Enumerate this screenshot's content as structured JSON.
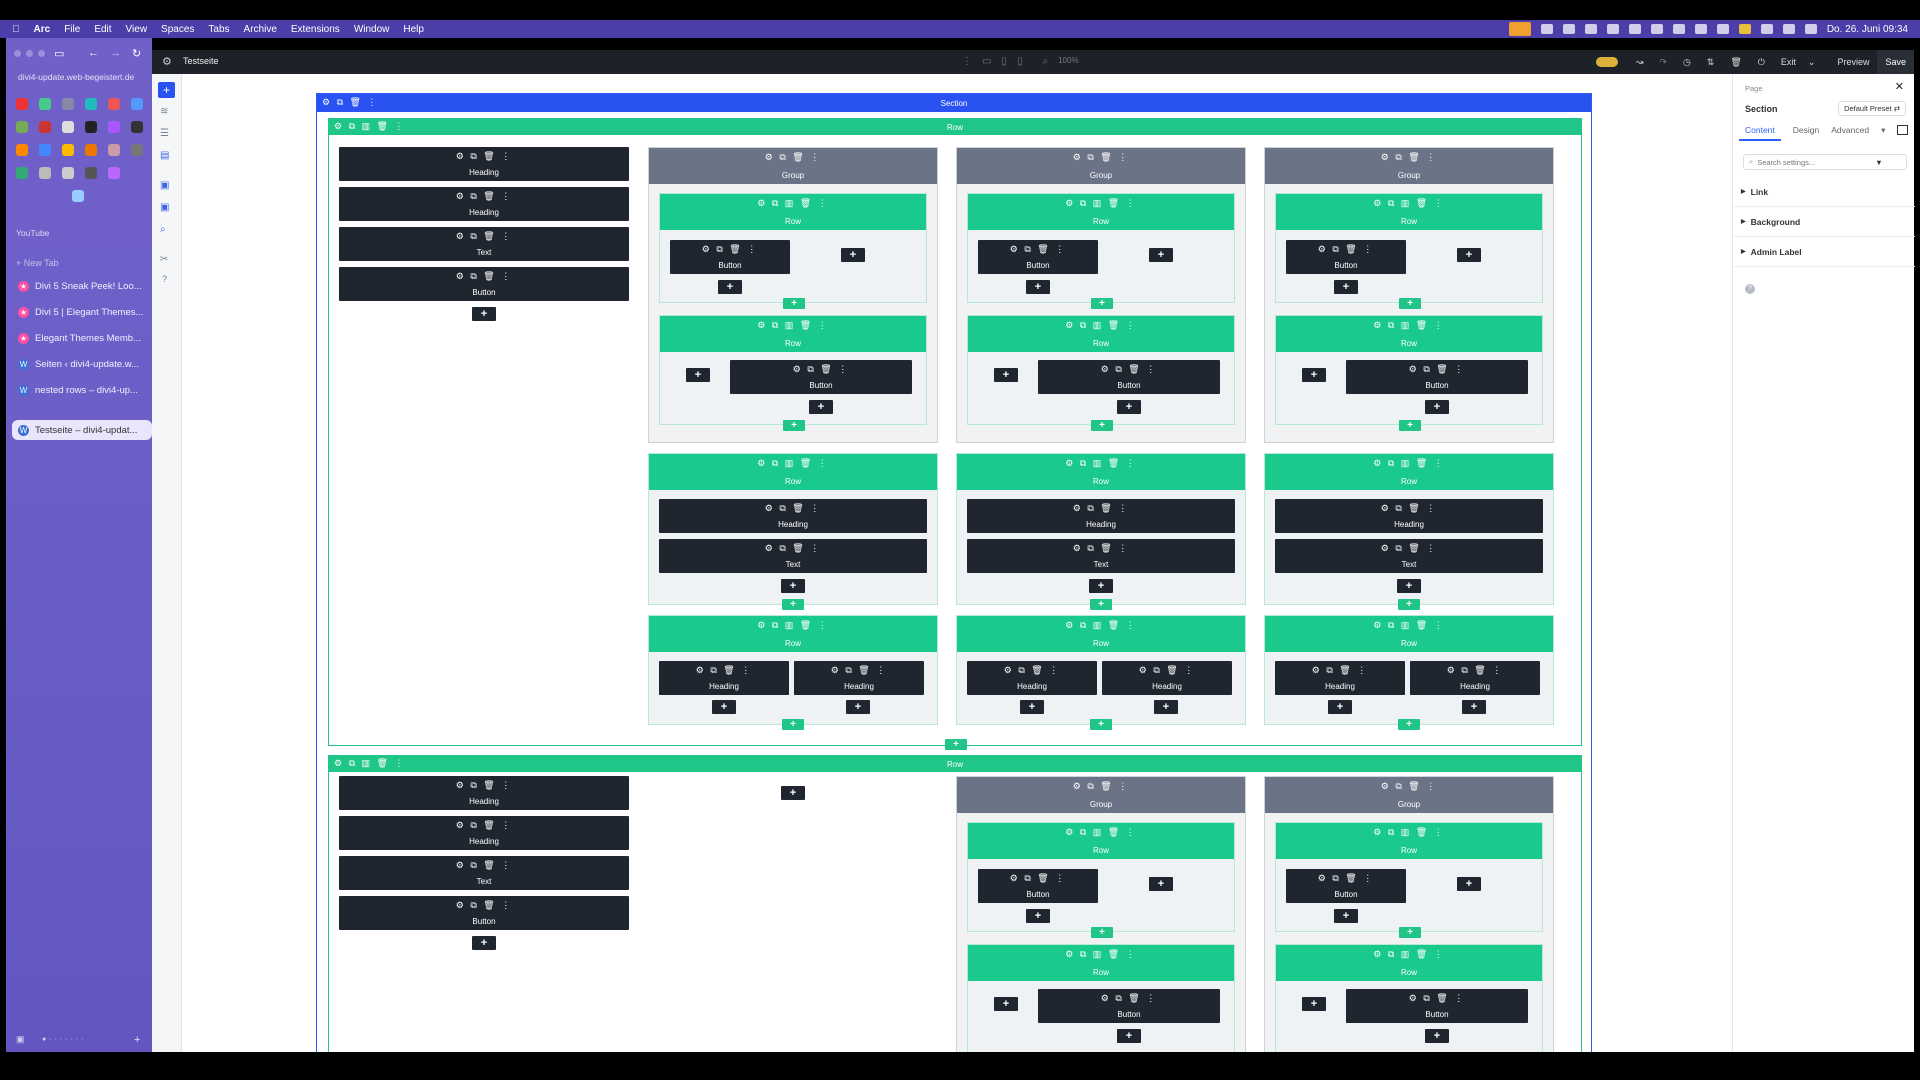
{
  "menubar": {
    "app": "Arc",
    "items": [
      "File",
      "Edit",
      "View",
      "Spaces",
      "Tabs",
      "Archive",
      "Extensions",
      "Window",
      "Help"
    ],
    "datetime": "Do. 26. Juni 09:34"
  },
  "arc": {
    "url": "divi4-update.web-begeistert.de",
    "youtube": "YouTube",
    "new_tab": "+ New Tab",
    "tabs": [
      {
        "label": "Divi 5 Sneak Peek! Loo...",
        "icon": "divi-icon"
      },
      {
        "label": "Divi 5 | Elegant Themes...",
        "icon": "divi-icon"
      },
      {
        "label": "Elegant Themes Memb...",
        "icon": "divi-icon"
      },
      {
        "label": "Seiten ‹ divi4-update.w...",
        "icon": "wordpress-icon"
      },
      {
        "label": "nested rows – divi4-up...",
        "icon": "wordpress-icon"
      },
      {
        "label": "Testseite – divi4-updat...",
        "icon": "wordpress-icon",
        "active": true
      }
    ]
  },
  "topbar": {
    "page_title": "Testseite",
    "zoom": "100%",
    "exit": "Exit",
    "preview": "Preview",
    "save": "Save"
  },
  "builder": {
    "section_label": "Section",
    "row_label": "Row",
    "group_label": "Group",
    "heading_label": "Heading",
    "text_label": "Text",
    "button_label": "Button",
    "icons_module": "⚙ ⧉ 🗑 ⋮",
    "icons_row": "⚙ ⧉ ▥ 🗑 ⋮",
    "plus": "+"
  },
  "settings": {
    "breadcrumb": "Page",
    "title": "Section",
    "preset": "Default Preset",
    "tabs": [
      "Content",
      "Design",
      "Advanced"
    ],
    "search_placeholder": "Search settings...",
    "groups": [
      "Link",
      "Background",
      "Admin Label"
    ]
  },
  "colors": {
    "section_blue": "#2952f1",
    "row_green": "#1fc688",
    "group_gray": "#6b7486",
    "module_dark": "#1f2630"
  }
}
